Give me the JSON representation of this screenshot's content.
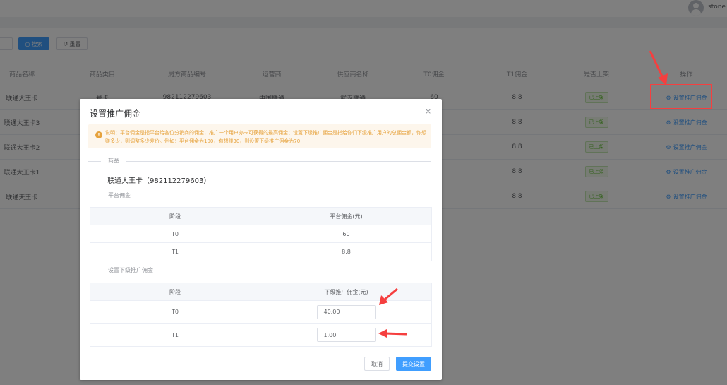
{
  "header": {
    "username": "stone"
  },
  "filters": {
    "search_label": "搜索",
    "reset_label": "重置"
  },
  "table": {
    "columns": [
      "商品名称",
      "商品类目",
      "局方商品编号",
      "运营商",
      "供应商名称",
      "T0佣金",
      "T1佣金",
      "是否上架",
      "操作"
    ],
    "rows": [
      {
        "name": "联通大王卡",
        "category": "号卡",
        "code": "982112279603",
        "operator": "中国联通",
        "supplier": "武汉联通",
        "t0": "60",
        "t1": "8.8",
        "status": "已上架",
        "action": "设置推广佣金"
      },
      {
        "name": "联通大王卡3",
        "category": "",
        "code": "",
        "operator": "",
        "supplier": "",
        "t0": "",
        "t1": "8.8",
        "status": "已上架",
        "action": "设置推广佣金"
      },
      {
        "name": "联通大王卡2",
        "category": "",
        "code": "",
        "operator": "",
        "supplier": "",
        "t0": "",
        "t1": "8.8",
        "status": "已上架",
        "action": "设置推广佣金"
      },
      {
        "name": "联通大王卡1",
        "category": "",
        "code": "",
        "operator": "",
        "supplier": "",
        "t0": "",
        "t1": "8.8",
        "status": "已上架",
        "action": "设置推广佣金"
      },
      {
        "name": "联通天王卡",
        "category": "",
        "code": "",
        "operator": "",
        "supplier": "",
        "t0": "",
        "t1": "8.8",
        "status": "已上架",
        "action": "设置推广佣金"
      }
    ]
  },
  "dialog": {
    "title": "设置推广佣金",
    "close": "×",
    "notice_icon": "!",
    "notice": "说明：平台佣金是指平台给各位分销商的佣金，推广一个用户办卡可获得的最高佣金；设置下级推广佣金是指给你们下级推广用户的总佣金额，你想赚多少，则调整多少差价。例如：平台佣金为100，你想赚30，则设置下级推广佣金为70",
    "section_product": "商品",
    "product": "联通大王卡（982112279603）",
    "section_platform": "平台佣金",
    "platform_headers": [
      "阶段",
      "平台佣金(元)"
    ],
    "platform_rows": [
      {
        "stage": "T0",
        "amount": "60"
      },
      {
        "stage": "T1",
        "amount": "8.8"
      }
    ],
    "section_sub": "设置下级推广佣金",
    "sub_headers": [
      "阶段",
      "下级推广佣金(元)"
    ],
    "sub_rows": [
      {
        "stage": "T0",
        "value": "40.00"
      },
      {
        "stage": "T1",
        "value": "1.00"
      }
    ],
    "cancel_label": "取消",
    "submit_label": "提交设置"
  },
  "colors": {
    "primary": "#409eff",
    "warning": "#e6a23c",
    "success": "#67c23a",
    "annotation": "#f53f3f"
  },
  "icons": [
    "user-avatar-icon",
    "search-icon",
    "reset-icon",
    "gear-icon",
    "close-icon",
    "warning-icon"
  ]
}
